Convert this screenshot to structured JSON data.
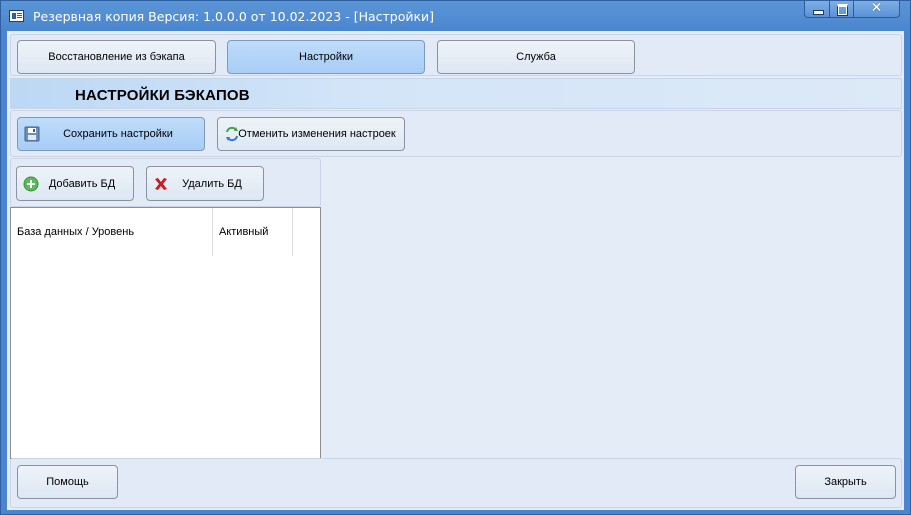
{
  "window": {
    "title": "Резервная копия   Версия: 1.0.0.0 от 10.02.2023 - [Настройки]",
    "controls": {
      "close_symbol": "✕"
    }
  },
  "tabs": [
    {
      "label": "Восстановление из бэкапа",
      "active": false
    },
    {
      "label": "Настройки",
      "active": true
    },
    {
      "label": "Служба",
      "active": false
    }
  ],
  "section": {
    "title": "НАСТРОЙКИ БЭКАПОВ"
  },
  "toolbar": {
    "save_label": "Сохранить настройки",
    "save_icon": "floppy-disk-icon",
    "cancel_label": "Отменить изменения настроек",
    "cancel_icon": "undo-arrows-icon"
  },
  "db_toolbar": {
    "add_label": "Добавить БД",
    "add_icon": "plus-circle-icon",
    "delete_label": "Удалить БД",
    "delete_icon": "red-x-icon"
  },
  "grid": {
    "columns": [
      {
        "label": "База данных / Уровень"
      },
      {
        "label": "Активный"
      }
    ],
    "rows": []
  },
  "footer": {
    "help_label": "Помощь",
    "close_label": "Закрыть"
  },
  "colors": {
    "title_bar": "#4b86cd",
    "client_bg": "#e4ecf7",
    "active_tab": "#a8cdf6",
    "section_header": "#bcd8f5"
  }
}
